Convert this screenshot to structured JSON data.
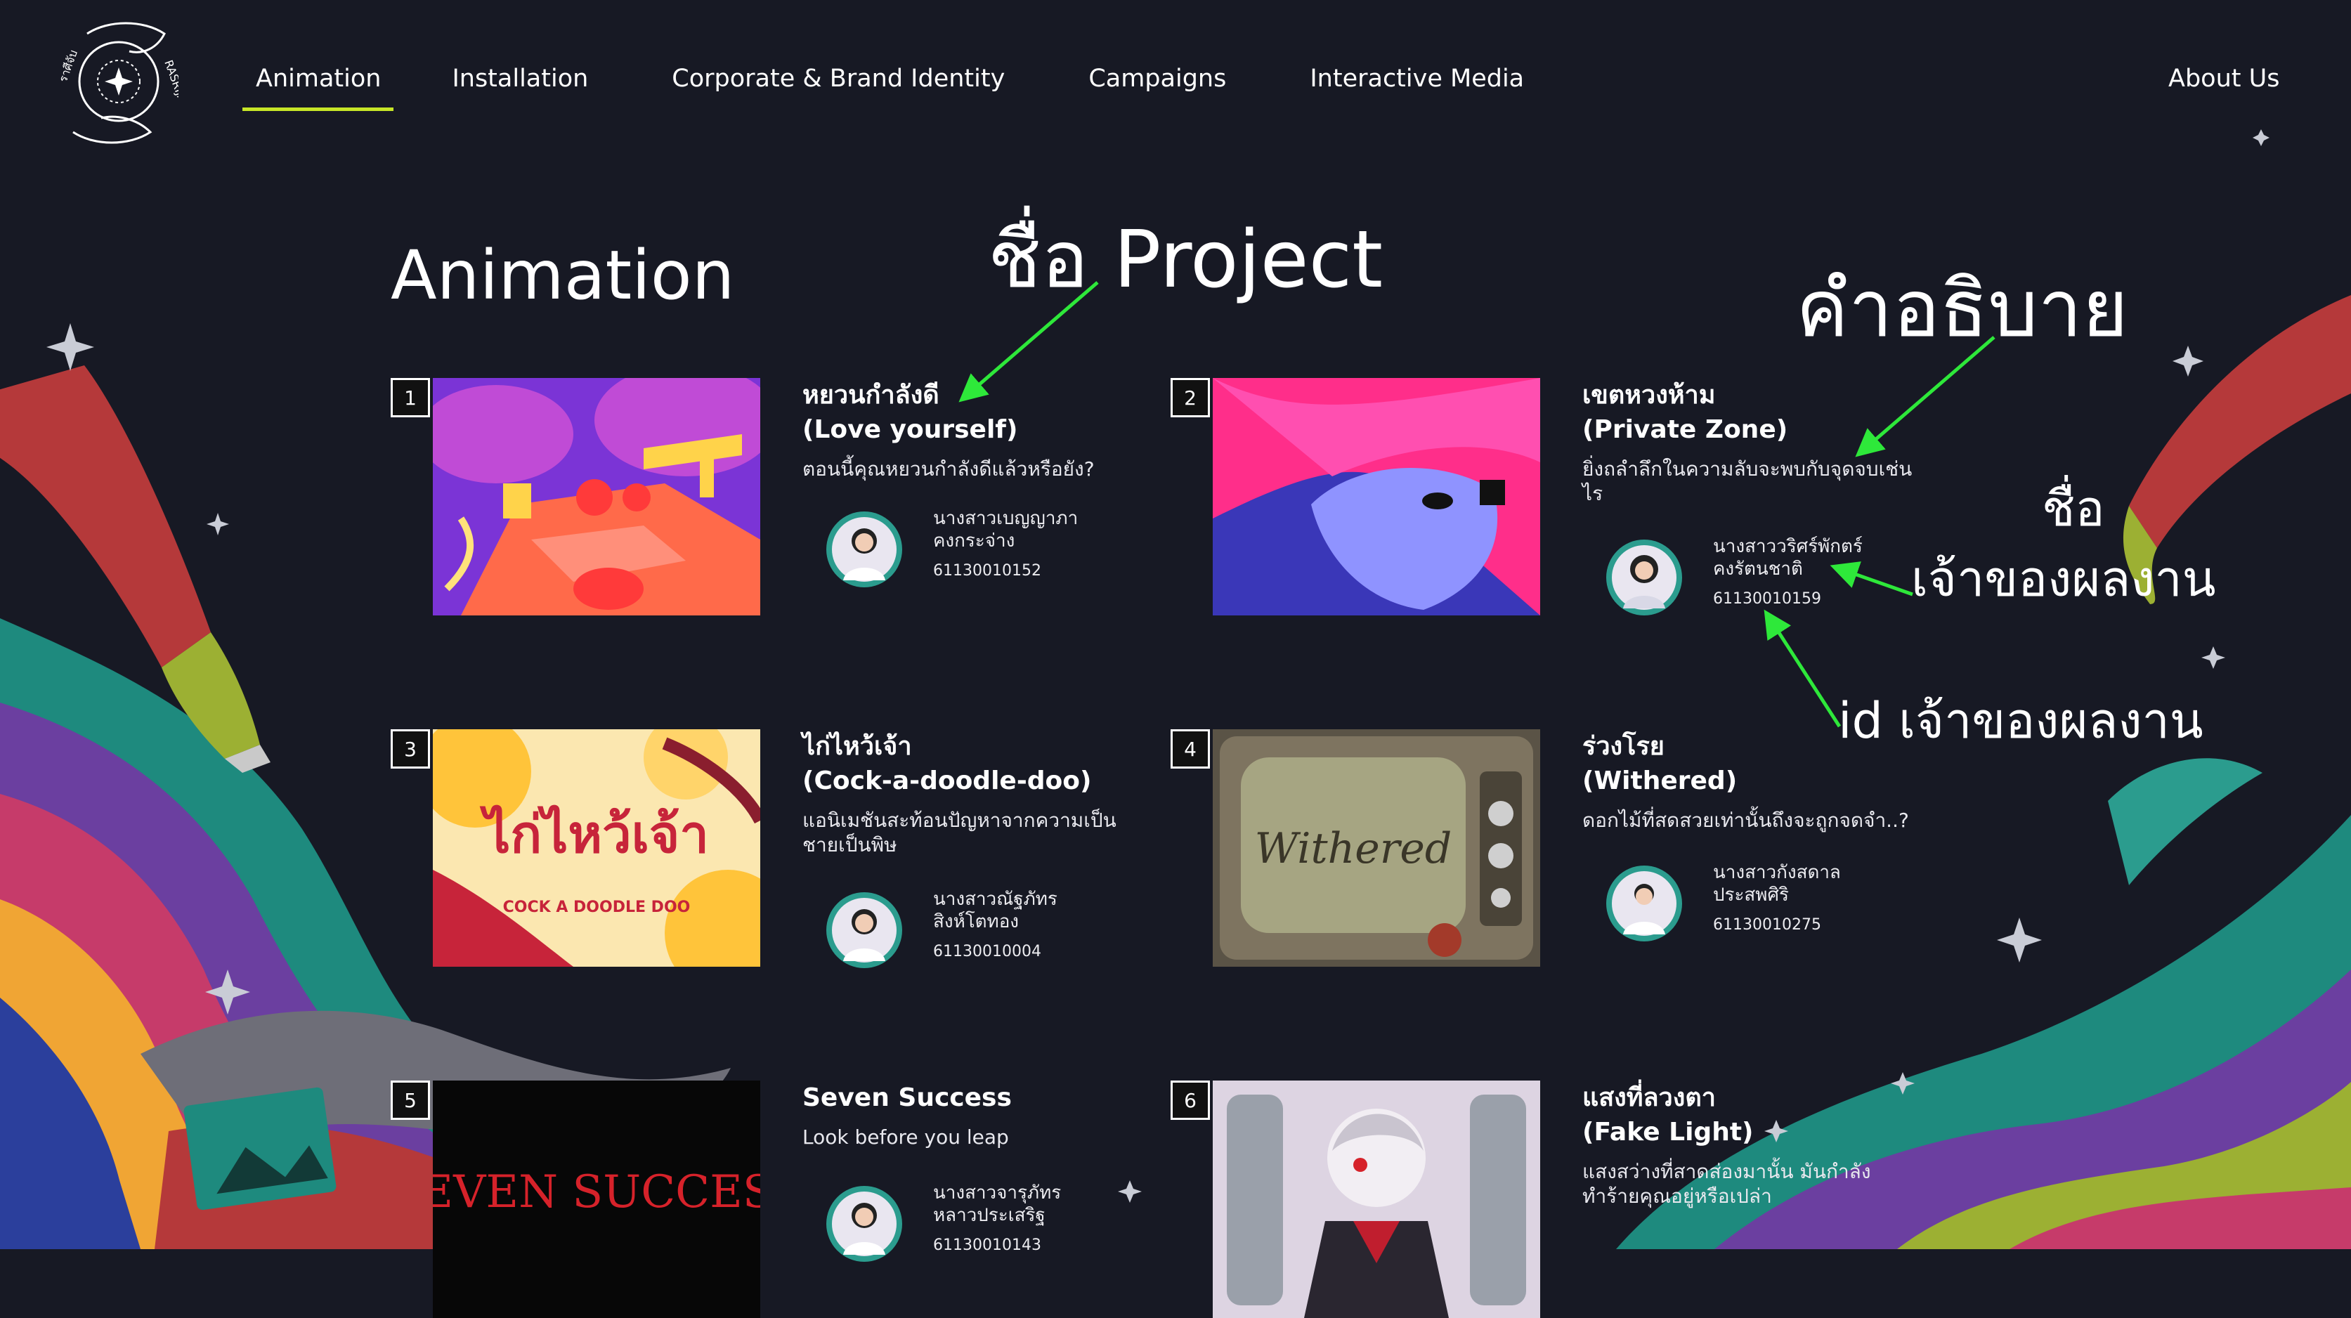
{
  "logo": {
    "text": "ราศีจับ RASRIJAB"
  },
  "nav": {
    "items": [
      {
        "label": "Animation",
        "active": true
      },
      {
        "label": "Installation"
      },
      {
        "label": "Corporate & Brand Identity"
      },
      {
        "label": "Campaigns"
      },
      {
        "label": "Interactive Media"
      }
    ],
    "about": "About Us"
  },
  "page": {
    "title": "Animation"
  },
  "colors": {
    "background": "#171924",
    "accent": "#c7e627",
    "annotation_arrow": "#2ee83a"
  },
  "projects": [
    {
      "num": "1",
      "title": "หยวนกำลังดี",
      "subtitle": "(Love yourself)",
      "description": "ตอนนี้คุณหยวนกำลังดีแล้วหรือยัง?",
      "owner_line1": "นางสาวเบญญาภา",
      "owner_line2": "คงกระจ่าง",
      "owner_id": "61130010152"
    },
    {
      "num": "2",
      "title": "เขตหวงห้าม",
      "subtitle": "(Private Zone)",
      "description": "ยิ่งถลำลึกในความลับจะพบกับจุดจบเช่นไร",
      "owner_line1": "นางสาววริศร์พักตร์",
      "owner_line2": "คงรัตนชาติ",
      "owner_id": "61130010159"
    },
    {
      "num": "3",
      "title": "ไก่ไหว้เจ้า",
      "subtitle": "(Cock-a-doodle-doo)",
      "description": "แอนิเมชันสะท้อนปัญหาจากความเป็นชายเป็นพิษ",
      "owner_line1": "นางสาวณัฐภัทร",
      "owner_line2": "สิงห์โตทอง",
      "owner_id": "61130010004"
    },
    {
      "num": "4",
      "title": "ร่วงโรย",
      "subtitle": "(Withered)",
      "description": "ดอกไม้ที่สดสวยเท่านั้นถึงจะถูกจดจำ..?",
      "owner_line1": "นางสาวกังสดาล",
      "owner_line2": "ประสพศิริ",
      "owner_id": "61130010275"
    },
    {
      "num": "5",
      "title": "Seven Success",
      "subtitle": "",
      "description": "Look before you leap",
      "owner_line1": "นางสาวจารุภัทร",
      "owner_line2": "หลาวประเสริฐ",
      "owner_id": "61130010143"
    },
    {
      "num": "6",
      "title": "แสงที่ลวงตา",
      "subtitle": "(Fake Light)",
      "description": "แสงสว่างที่สาดส่องมานั้น มันกำลังทำร้ายคุณอยู่หรือเปล่า",
      "owner_line1": "",
      "owner_line2": "",
      "owner_id": ""
    }
  ],
  "thumb_texts": {
    "p3": "ไก่ไหว้เจ้า",
    "p3_small": "COCK A DOODLE DOO",
    "p4": "Withered",
    "p5": "SEVEN SUCCESS"
  },
  "annotations": {
    "project_name": "ชื่อ Project",
    "description": "คำอธิบาย",
    "owner_name_1": "ชื่อ",
    "owner_name_2": "เจ้าของผลงาน",
    "owner_id": "id เจ้าของผลงาน"
  }
}
